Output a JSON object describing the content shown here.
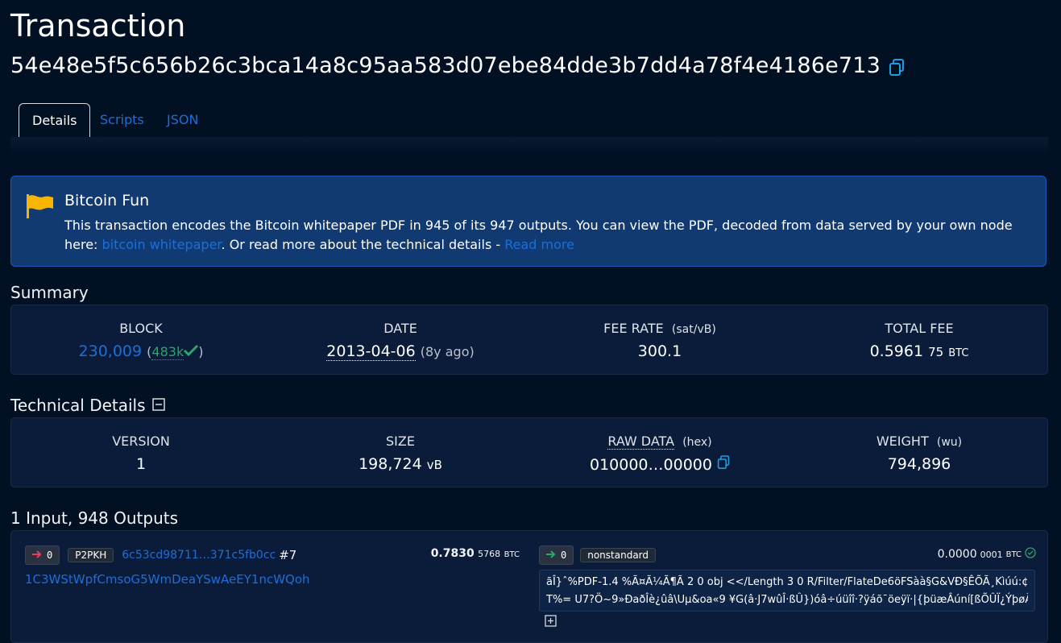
{
  "title": "Transaction",
  "txid": "54e48e5f5c656b26c3bca14a8c95aa583d07ebe84dde3b7dd4a78f4e4186e713",
  "tabs": [
    "Details",
    "Scripts",
    "JSON"
  ],
  "alert": {
    "title": "Bitcoin Fun",
    "text1": "This transaction encodes the Bitcoin whitepaper PDF in 945 of its 947 outputs. You can view the PDF, decoded from data served by your own node here: ",
    "link1": "bitcoin whitepaper",
    "text2": ". Or read more about the technical details - ",
    "link2": "Read more"
  },
  "summary": {
    "title": "Summary",
    "block_label": "BLOCK",
    "block_value": "230,009",
    "confirmations": "483k",
    "date_label": "DATE",
    "date_value": "2013-04-06",
    "date_ago": "(8y ago)",
    "fee_rate_label": "FEE RATE",
    "fee_rate_unit": "(sat/vB)",
    "fee_rate_value": "300.1",
    "total_fee_label": "TOTAL FEE",
    "total_fee_main": "0.5961",
    "total_fee_small": "75",
    "total_fee_unit": "BTC"
  },
  "technical": {
    "title": "Technical Details",
    "version_label": "VERSION",
    "version_value": "1",
    "size_label": "SIZE",
    "size_value": "198,724",
    "size_unit": "vB",
    "raw_label": "RAW DATA",
    "raw_unit": "(hex)",
    "raw_value": "010000…00000",
    "weight_label": "WEIGHT",
    "weight_unit": "(wu)",
    "weight_value": "794,896"
  },
  "io": {
    "title": "1 Input, 948 Outputs",
    "input": {
      "index": "0",
      "type": "P2PKH",
      "prev_tx": "6c53cd98711…371c5fb0cc",
      "prev_vout": "#7",
      "amount_main": "0.7830",
      "amount_small": "5768",
      "unit": "BTC",
      "address": "1C3WStWpfCmsoG5WmDeaYSwAeEY1ncWQoh"
    },
    "output": {
      "index": "0",
      "type": "nonstandard",
      "amount_main": "0.0000",
      "amount_small": "0001",
      "unit": "BTC",
      "script_line1": "ãÎ}ˆ%PDF-1.4 %Ã¤Ã¼Ã¶Ã 2 0 obj <</Length 3 0 R/Filter/FlateDe6öFSàà§G&VÐ§ÊÕÃ¸Kìúú:¢V",
      "script_line2": "T%= U7?Ö~9»ÐaðÎè¿ûâ\\Uµ&oa«9 ¥G(â·J7wûÎ·ßÛ})óâ÷úüîî·?ÿáõ¯öeÿï·|{þüæÂúní[ßÕÛÏ¿ÝþøÃÝ\\ùì"
    }
  }
}
